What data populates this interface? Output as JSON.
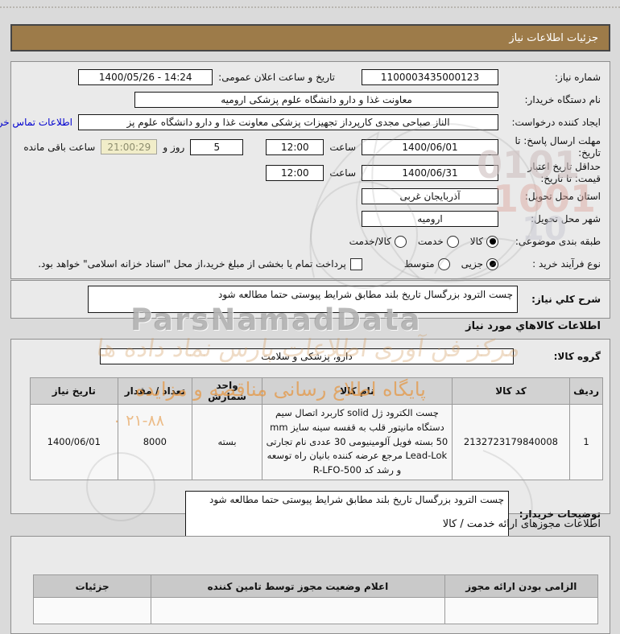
{
  "title_bar": {
    "title": "جزئیات اطلاعات نیاز"
  },
  "form": {
    "need_number": {
      "label": "شماره نیاز:",
      "value": "1100003435000123"
    },
    "announce": {
      "label": "تاریخ و ساعت اعلان عمومی:",
      "value": "1400/05/26 - 14:24"
    },
    "buyer_org": {
      "label": "نام دستگاه خریدار:",
      "value": "معاونت غذا و دارو دانشگاه علوم پزشکی ارومیه"
    },
    "creator": {
      "label": "ایجاد کننده درخواست:",
      "value": "الناز صباحی مجدی کارپرداز تجهیزات پزشکی معاونت غذا و دارو دانشگاه علوم پز",
      "contact_link": "اطلاعات تماس خریدار"
    },
    "deadline": {
      "label": "مهلت ارسال پاسخ: تا تاریخ:",
      "date": "1400/06/01",
      "hour_label": "ساعت",
      "hour": "12:00",
      "days_value": "5",
      "days_label": "روز و",
      "countdown": "21:00:29",
      "remaining_label": "ساعت باقی مانده"
    },
    "validity": {
      "label": "حداقل تاریخ اعتبار قیمت: تا تاریخ:",
      "date": "1400/06/31",
      "hour_label": "ساعت",
      "hour": "12:00"
    },
    "province": {
      "label": "استان محل تحویل:",
      "value": "آذربایجان غربی"
    },
    "city": {
      "label": "شهر محل تحویل:",
      "value": "ارومیه"
    },
    "subject_class": {
      "label": "طبقه بندی موضوعی:",
      "options": [
        {
          "label": "کالا",
          "selected": true
        },
        {
          "label": "خدمت",
          "selected": false
        },
        {
          "label": "کالا/خدمت",
          "selected": false
        }
      ]
    },
    "process_type": {
      "label": "نوع فرآیند خرید :",
      "options": [
        {
          "label": "جزیی",
          "selected": true
        },
        {
          "label": "متوسط",
          "selected": false
        }
      ],
      "payment_note": "پرداخت تمام یا بخشی از مبلغ خرید،از محل \"اسناد خزانه اسلامی\" خواهد بود."
    }
  },
  "general_desc": {
    "label": "شرح کلي نیاز:",
    "value": "چست الترود بزرگسال تاریخ بلند مطابق شرایط پیوستی حتما مطالعه شود"
  },
  "goods_section": {
    "heading": "اطلاعات کالاهاي مورد نیاز",
    "group_label": "گروه کالا:",
    "group_value": "دارو، پزشکی و سلامت",
    "table": {
      "headers": [
        "ردیف",
        "کد کالا",
        "نام کالا",
        "واحد شمارش",
        "تعداد / مقدار",
        "تاریخ نیاز"
      ],
      "rows": [
        [
          "1",
          "2132723179840008",
          "چست الکترود ژل solid کاربرد اتصال سیم دستگاه مانیتور قلب به قفسه سینه سایز mm 50 بسته فویل آلومینیومی 30 عددی نام تجارتی Lead-Lok مرجع عرضه کننده بانیان راه توسعه و رشد کد R-LFO-500",
          "بسته",
          "8000",
          "1400/06/01"
        ]
      ]
    }
  },
  "buyer_notes": {
    "label": "توضیحات خریدار:",
    "value": "چست الترود بزرگسال تاریخ بلند مطابق شرایط پیوستی حتما مطالعه شود"
  },
  "permits_section": {
    "heading": "اطلاعات مجوزهای ارائه خدمت / کالا",
    "table": {
      "headers": [
        "الزامی بودن ارائه مجوز",
        "اعلام وضعیت مجوز توسط تامین کننده",
        "جزئیات"
      ]
    }
  },
  "watermark": {
    "brand": "ParsNamadData",
    "calligraphy": "مرکز فن آوری اطلاعات پارس نماد داده ها",
    "tagline": "پایگاه اطلاع رسانی مناقصه و مزایده",
    "phone": "۲۱-۸۸ ۰",
    "digits1": "0101",
    "digits2": "1001",
    "digits3": "10"
  },
  "colors": {
    "title_bar_bg": "#9d7b49",
    "timer_bg": "#f1edc9",
    "link": "#0000cf",
    "watermark_orange": "#e4943e"
  }
}
